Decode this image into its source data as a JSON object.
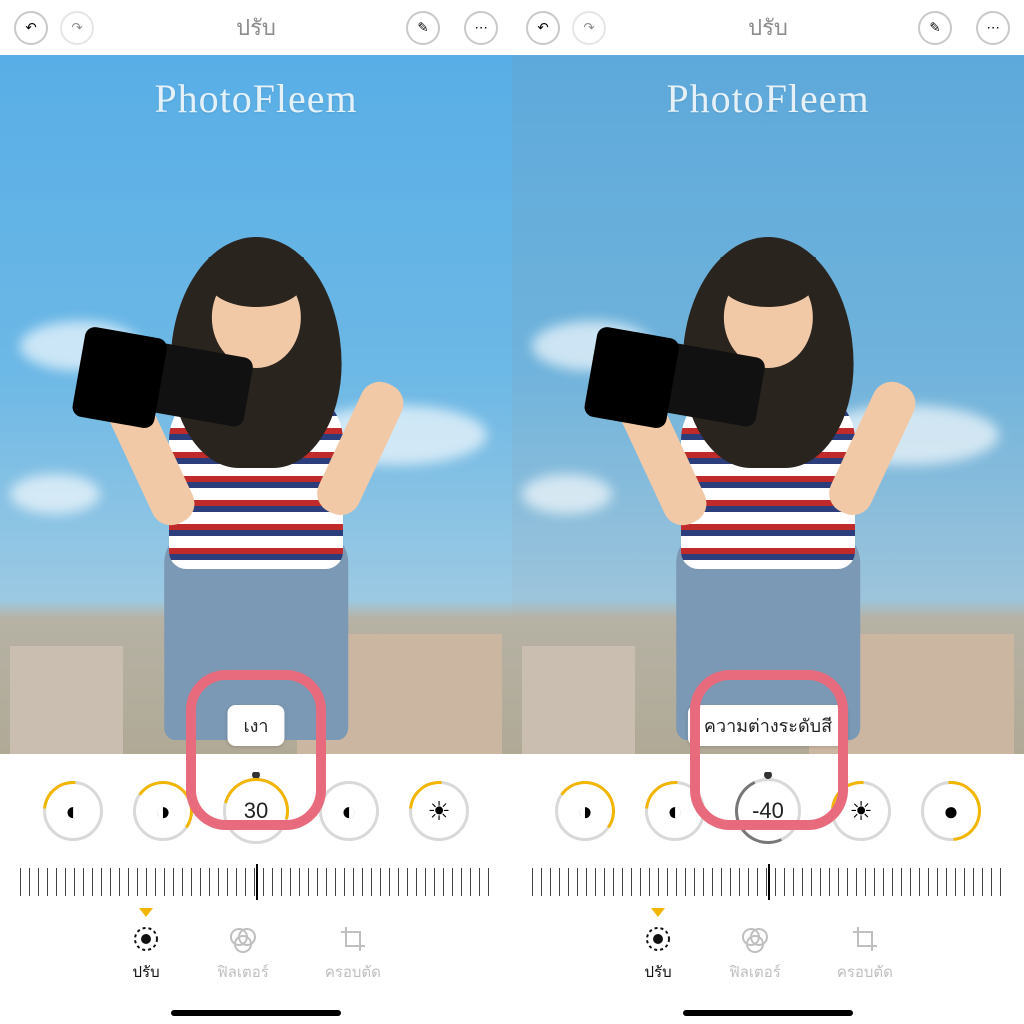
{
  "watermark": "PhotoFleem",
  "header_title": "ปรับ",
  "tabs": {
    "adjust": "ปรับ",
    "filters": "ฟิลเตอร์",
    "crop": "ครอบตัด"
  },
  "left": {
    "adjustment_label": "เงา",
    "adjustment_value": "30"
  },
  "right": {
    "adjustment_label": "ความต่างระดับสี",
    "adjustment_value": "-40"
  }
}
